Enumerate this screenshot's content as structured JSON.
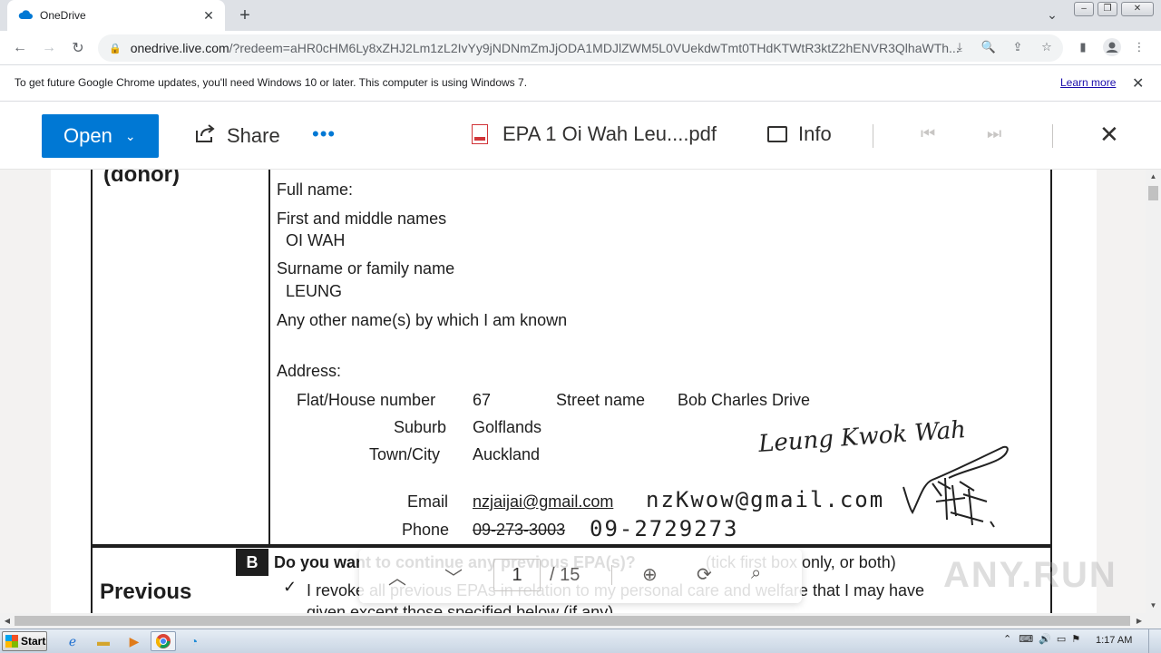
{
  "browser": {
    "tab": {
      "title": "OneDrive",
      "close": "✕"
    },
    "new_tab": "+",
    "url": {
      "host": "onedrive.live.com",
      "path": "/?redeem=aHR0cHM6Ly8xZHJ2Lm1zL2IvYy9jNDNmZmJjODA1MDJlZWM5L0VUekdwTmt0THdKTWtR3ktZ2hENVR3QlhaWTh..."
    },
    "infobar": {
      "message": "To get future Google Chrome updates, you'll need Windows 10 or later. This computer is using Windows 7.",
      "link": "Learn more"
    }
  },
  "viewer": {
    "open_label": "Open",
    "share_label": "Share",
    "more_label": "•••",
    "file_name": "EPA 1 Oi Wah Leu....pdf",
    "info_label": "Info"
  },
  "document": {
    "donor_heading": "(donor)",
    "full_name_label": "Full name:",
    "first_names_label": "First and middle names",
    "first_names_value": "OI WAH",
    "surname_label": "Surname or family name",
    "surname_value": "LEUNG",
    "other_names_label": "Any other name(s) by which I am known",
    "address_label": "Address:",
    "house_label": "Flat/House number",
    "house_value": "67",
    "street_label": "Street name",
    "street_value": "Bob Charles Drive",
    "suburb_label": "Suburb",
    "suburb_value": "Golflands",
    "city_label": "Town/City",
    "city_value": "Auckland",
    "email_label": "Email",
    "email_old": "nzjaijai@gmail.com",
    "email_new": "nzKwow@gmail.com",
    "phone_label": "Phone",
    "phone_old": "09-273-3003",
    "phone_new": "09-2729273",
    "handwritten_name": "Leung Kwok Wah",
    "section_letter": "B",
    "section_heading": "Previous",
    "question_bold": "Do you want to continue any previous EPA(s)?",
    "question_hint": "(tick first box only, or both)",
    "check_mark": "✓",
    "revoke_text": "I revoke all previous EPAs in relation to my personal care and welfare that I may have",
    "revoke_text_2": "given except those specified below (if any)"
  },
  "pdf_toolbar": {
    "current_page": "1",
    "total_pages": "/ 15"
  },
  "watermark": "ANY.RUN",
  "taskbar": {
    "start_label": "Start",
    "clock": "1:17 AM"
  }
}
